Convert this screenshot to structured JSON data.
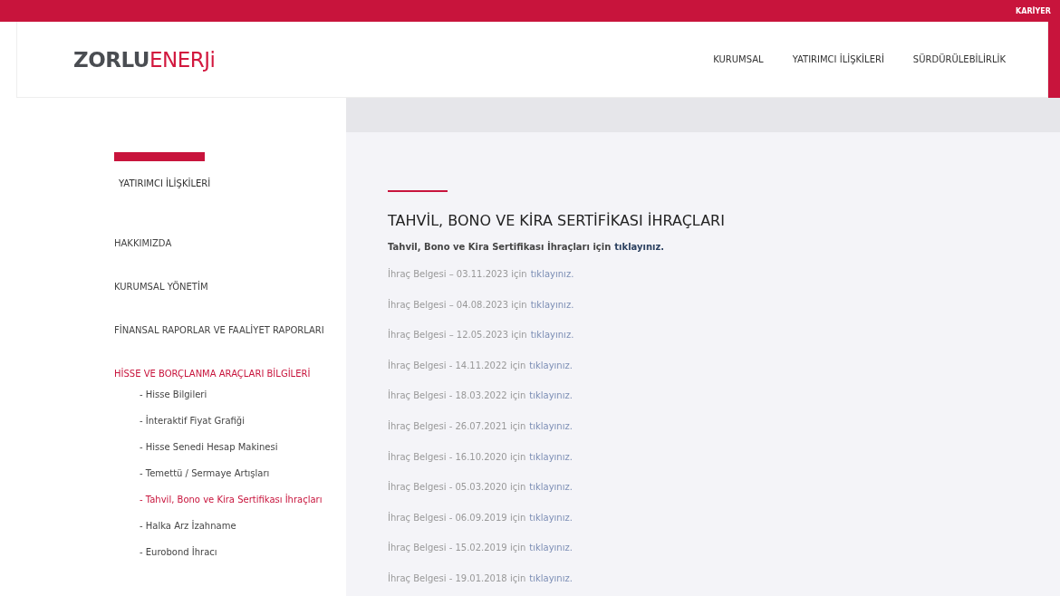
{
  "top_bar": {
    "link": "KARİYER"
  },
  "header": {
    "logo": {
      "part_1": "ZORLU",
      "part_2": "ENERJi"
    },
    "nav": [
      {
        "label": "KURUMSAL",
        "selected": false
      },
      {
        "label": "YATIRIMCI İLİŞKİLERİ",
        "selected": false
      },
      {
        "label": "SÜRDÜRÜLEBİLİRLİK",
        "selected": false
      }
    ]
  },
  "sidebar": {
    "heading": "YATIRIMCI İLİŞKİLERİ",
    "items": [
      {
        "label": "HAKKIMIZDA",
        "selected": false
      },
      {
        "label": "KURUMSAL YÖNETİM",
        "selected": false
      },
      {
        "label": "FİNANSAL RAPORLAR VE FAALİYET RAPORLARI",
        "selected": false
      },
      {
        "label": "HİSSE VE BORÇLANMA ARAÇLARI BİLGİLERİ",
        "selected": true,
        "children": [
          {
            "label": "- Hisse Bilgileri",
            "selected": false
          },
          {
            "label": "- İnteraktif Fiyat Grafiği",
            "selected": false
          },
          {
            "label": "- Hisse Senedi Hesap Makinesi",
            "selected": false
          },
          {
            "label": "- Temettü / Sermaye Artışları",
            "selected": false
          },
          {
            "label": "- Tahvil, Bono ve Kira Sertifikası İhraçları",
            "selected": true
          },
          {
            "label": "- Halka Arz İzahname",
            "selected": false
          },
          {
            "label": "- Eurobond İhracı",
            "selected": false
          }
        ]
      }
    ]
  },
  "content": {
    "title": "TAHVİL, BONO VE KİRA SERTİFİKASI İHRAÇLARI",
    "intro": {
      "text": "Tahvil, Bono ve Kira Sertifikası İhraçları için",
      "link": "tıklayınız."
    },
    "documents": [
      {
        "text": "İhraç Belgesi – 03.11.2023 için",
        "link": "tıklayınız."
      },
      {
        "text": "İhraç Belgesi – 04.08.2023 için",
        "link": "tıklayınız."
      },
      {
        "text": "İhraç Belgesi – 12.05.2023 için",
        "link": "tıklayınız."
      },
      {
        "text": "İhraç Belgesi - 14.11.2022 için",
        "link": "tıklayınız."
      },
      {
        "text": "İhraç Belgesi - 18.03.2022 için",
        "link": "tıklayınız."
      },
      {
        "text": "İhraç Belgesi - 26.07.2021 için",
        "link": "tıklayınız."
      },
      {
        "text": "İhraç Belgesi - 16.10.2020 için",
        "link": "tıklayınız."
      },
      {
        "text": "İhraç Belgesi - 05.03.2020 için",
        "link": "tıklayınız."
      },
      {
        "text": "İhraç Belgesi - 06.09.2019 için",
        "link": "tıklayınız."
      },
      {
        "text": "İhraç Belgesi - 15.02.2019 için",
        "link": "tıklayınız."
      },
      {
        "text": "İhraç Belgesi - 19.01.2018 için",
        "link": "tıklayınız."
      }
    ]
  }
}
